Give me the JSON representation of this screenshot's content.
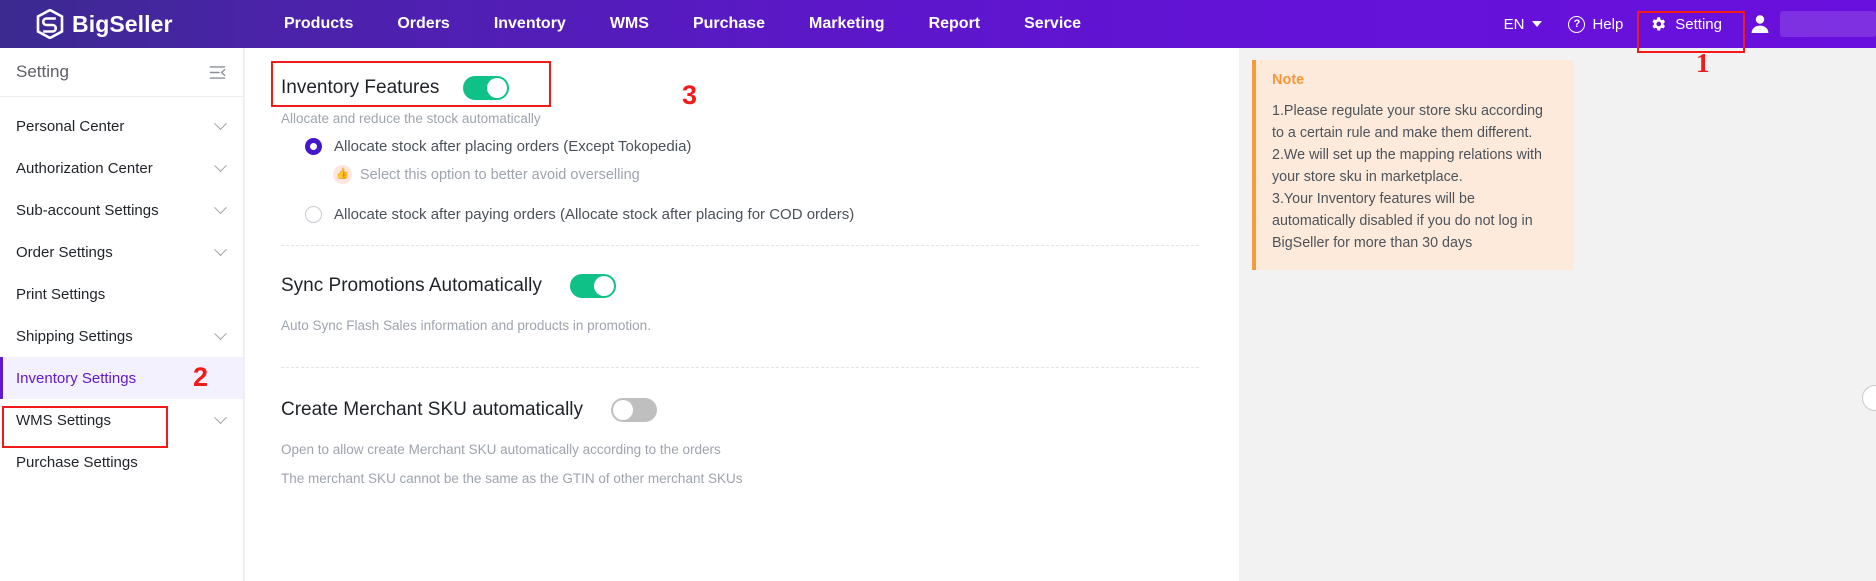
{
  "header": {
    "brand": "BigSeller",
    "nav": [
      {
        "label": "Products"
      },
      {
        "label": "Orders"
      },
      {
        "label": "Inventory"
      },
      {
        "label": "WMS"
      },
      {
        "label": "Purchase"
      },
      {
        "label": "Marketing"
      },
      {
        "label": "Report"
      },
      {
        "label": "Service"
      }
    ],
    "language": "EN",
    "help_label": "Help",
    "setting_label": "Setting"
  },
  "annotations": {
    "one": "1",
    "two": "2",
    "three": "3",
    "box_color": "#f31a1a"
  },
  "sidebar": {
    "title": "Setting",
    "items": [
      {
        "label": "Personal Center",
        "expandable": true,
        "active": false
      },
      {
        "label": "Authorization Center",
        "expandable": true,
        "active": false
      },
      {
        "label": "Sub-account Settings",
        "expandable": true,
        "active": false
      },
      {
        "label": "Order Settings",
        "expandable": true,
        "active": false
      },
      {
        "label": "Print Settings",
        "expandable": false,
        "active": false
      },
      {
        "label": "Shipping Settings",
        "expandable": true,
        "active": false
      },
      {
        "label": "Inventory Settings",
        "expandable": false,
        "active": true
      },
      {
        "label": "WMS Settings",
        "expandable": true,
        "active": false
      },
      {
        "label": "Purchase Settings",
        "expandable": false,
        "active": false
      }
    ]
  },
  "main": {
    "inventory_features": {
      "title": "Inventory Features",
      "toggle_state": "on",
      "subtitle": "Allocate and reduce the stock automatically",
      "options": [
        {
          "label": "Allocate stock after placing orders (Except Tokopedia)",
          "selected": true,
          "hint": "Select this option to better avoid overselling"
        },
        {
          "label": "Allocate stock after paying orders (Allocate stock after placing for COD orders)",
          "selected": false,
          "hint": ""
        }
      ]
    },
    "sync_promotions": {
      "title": "Sync Promotions Automatically",
      "toggle_state": "on",
      "description": "Auto Sync Flash Sales information and products in promotion."
    },
    "create_merchant_sku": {
      "title": "Create Merchant SKU automatically",
      "toggle_state": "off",
      "description_1": "Open to allow create Merchant SKU automatically according to the orders",
      "description_2": "The merchant SKU cannot be the same as the GTIN of other merchant SKUs"
    }
  },
  "note": {
    "title": "Note",
    "lines": [
      "1.Please regulate your store sku according",
      "to a certain rule and make them different.",
      "2.We will set up the mapping relations with",
      "your store sku in marketplace.",
      "3.Your Inventory features will be",
      "automatically disabled if you do not log in",
      "BigSeller for more than 30 days"
    ]
  },
  "colors": {
    "header_purple": "#5c17c9",
    "accent_purple": "#6119cf",
    "toggle_on_green": "#0fc186",
    "note_bg": "#fdeadb",
    "note_accent": "#f79a3e"
  }
}
